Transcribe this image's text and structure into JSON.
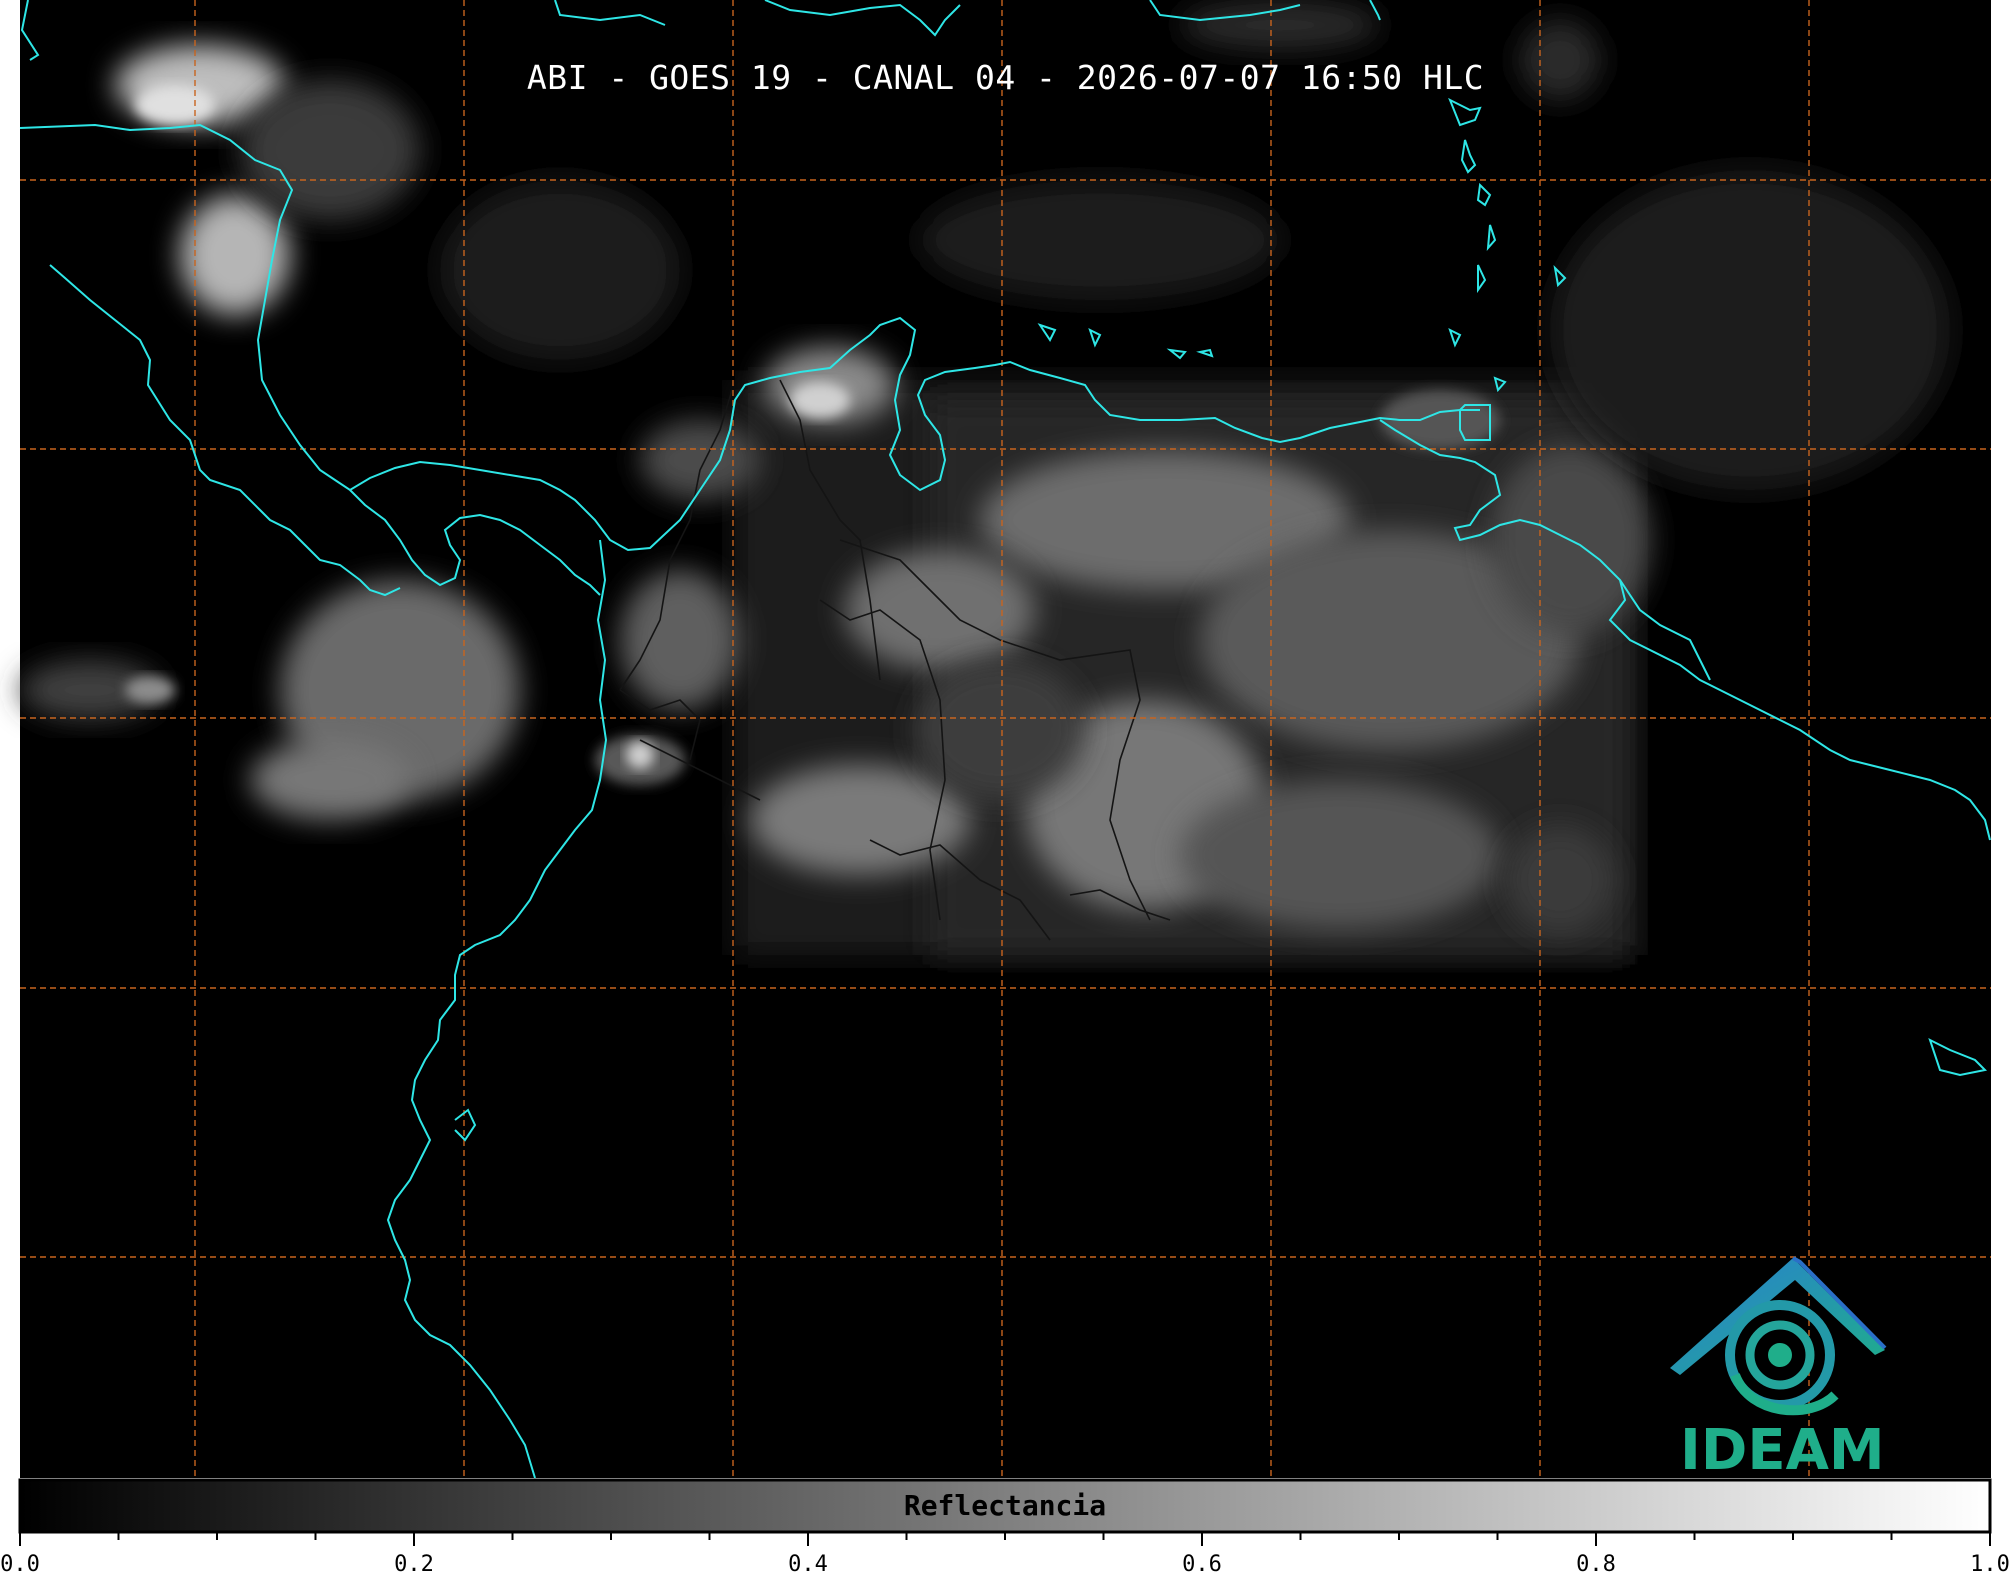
{
  "title": "ABI - GOES 19 - CANAL 04 - 2026-07-07 16:50 HLC",
  "colorbar": {
    "label": "Reflectancia",
    "tick_labels": [
      "0.0",
      "0.2",
      "0.4",
      "0.6",
      "0.8",
      "1.0"
    ],
    "range": [
      0.0,
      1.0
    ],
    "colormap": "grayscale black-to-white"
  },
  "logo": {
    "text": "IDEAM",
    "colors": {
      "roof_start": "#2a7fd1",
      "roof_end": "#1fae8a",
      "text": "#1fae8a"
    }
  },
  "colors": {
    "background": "#000000",
    "coastline": "#2ee6e6",
    "borders": "#1a1a1a",
    "graticule": "#c8641e",
    "clouds": "#bdbdbd"
  }
}
